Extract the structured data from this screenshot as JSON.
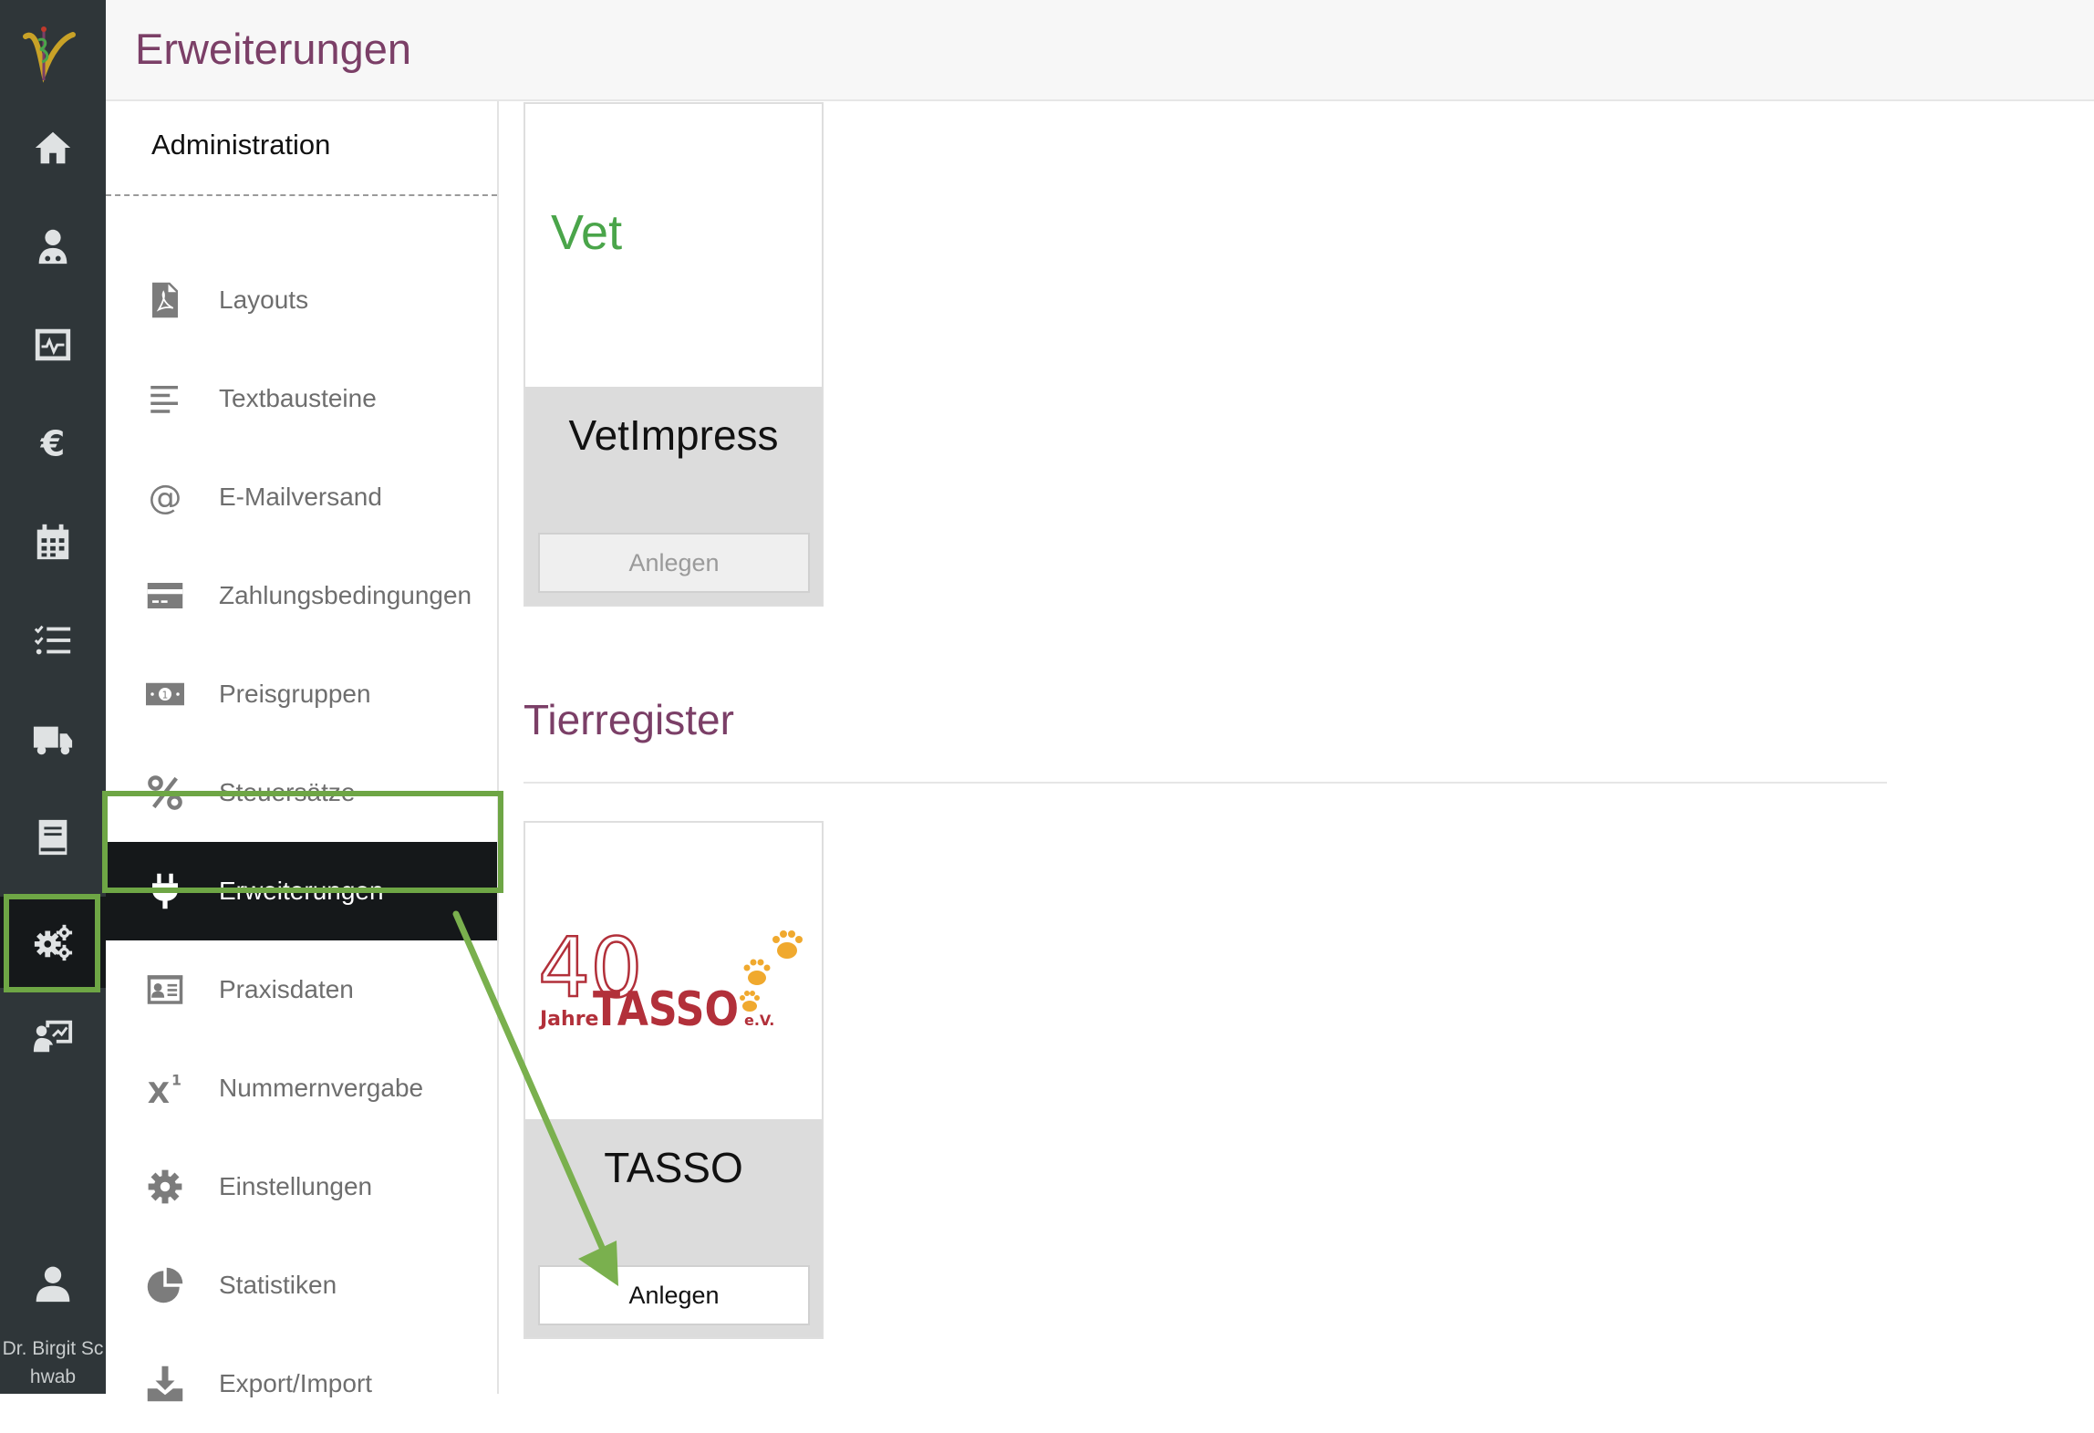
{
  "header": {
    "title": "Erweiterungen"
  },
  "rail": {
    "items": [
      {
        "icon": "home-icon"
      },
      {
        "icon": "doctor-icon"
      },
      {
        "icon": "monitor-icon"
      },
      {
        "icon": "euro-icon"
      },
      {
        "icon": "calendar-icon"
      },
      {
        "icon": "checklist-icon"
      },
      {
        "icon": "truck-icon"
      },
      {
        "icon": "book-icon"
      },
      {
        "icon": "gears-icon",
        "active": true
      },
      {
        "icon": "presentation-icon"
      }
    ],
    "user_name": "Dr. Birgit Sc\nhwab"
  },
  "submenu": {
    "title": "Administration",
    "items": [
      {
        "label": "Layouts",
        "icon": "pdf-file-icon"
      },
      {
        "label": "Textbausteine",
        "icon": "text-align-icon"
      },
      {
        "label": "E-Mailversand",
        "icon": "at-icon"
      },
      {
        "label": "Zahlungsbedingungen",
        "icon": "credit-card-icon"
      },
      {
        "label": "Preisgruppen",
        "icon": "banknote-icon"
      },
      {
        "label": "Steuersätze",
        "icon": "percent-icon"
      },
      {
        "label": "Erweiterungen",
        "icon": "plug-icon",
        "active": true
      },
      {
        "label": "Praxisdaten",
        "icon": "id-card-icon"
      },
      {
        "label": "Nummernvergabe",
        "icon": "superscript-icon"
      },
      {
        "label": "Einstellungen",
        "icon": "gear-icon"
      },
      {
        "label": "Statistiken",
        "icon": "pie-chart-icon"
      },
      {
        "label": "Export/Import",
        "icon": "download-icon"
      }
    ]
  },
  "cards": {
    "vetimpress": {
      "logo_text": "Vet",
      "name": "VetImpress",
      "button": "Anlegen",
      "button_enabled": false
    },
    "section_title": "Tierregister",
    "tasso": {
      "logo": {
        "number": "40",
        "jahre": "Jahre",
        "brand": "TASSO",
        "suffix": "e.V."
      },
      "name": "TASSO",
      "button": "Anlegen",
      "button_enabled": true
    }
  },
  "colors": {
    "rail_bg": "#2f3639",
    "active_bg": "#15181a",
    "brand_purple": "#7b3f67",
    "highlight_green": "#6ea645",
    "vet_green": "#4aa54a",
    "tasso_red": "#b2303a",
    "paw_orange": "#f0a92e"
  }
}
